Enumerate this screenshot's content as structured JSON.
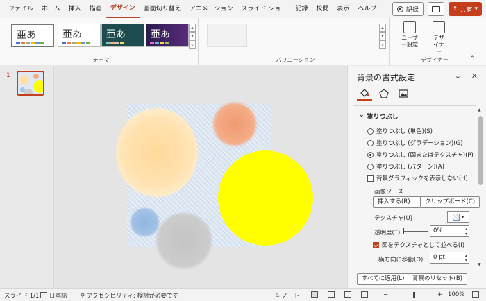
{
  "menubar": {
    "items": [
      "ファイル",
      "ホーム",
      "挿入",
      "描画",
      "デザイン",
      "画面切り替え",
      "アニメーション",
      "スライド ショー",
      "記録",
      "校閲",
      "表示",
      "ヘルプ"
    ],
    "active": "デザイン",
    "record_label": "記録",
    "share_label": "共有"
  },
  "ribbon": {
    "theme_group_label": "テーマ",
    "theme_glyph": "亜あ",
    "variation_group_label": "バリエーション",
    "designer_group_label": "デザイナー",
    "user_settings_label": "ユーザー設定",
    "designer_label": "デザイナー"
  },
  "thumbs": {
    "slide_number": "1"
  },
  "format_pane": {
    "title": "背景の書式設定",
    "section": "塗りつぶし",
    "options": [
      {
        "label": "塗りつぶし (単色)(S)",
        "selected": false
      },
      {
        "label": "塗りつぶし (グラデーション)(G)",
        "selected": false
      },
      {
        "label": "塗りつぶし (図またはテクスチャ)(P)",
        "selected": true
      },
      {
        "label": "塗りつぶし (パターン)(A)",
        "selected": false
      }
    ],
    "hide_graphics_label": "背景グラフィックを表示しない(H)",
    "image_source_label": "画像ソース",
    "insert_button": "挿入する(R)...",
    "clipboard_button": "クリップボード(C)",
    "texture_label": "テクスチャ(U)",
    "transparency_label": "透明度(T)",
    "transparency_value": "0%",
    "tile_label": "図をテクスチャとして並べる(I)",
    "offset_x_label": "横方向に移動(O)",
    "offset_x_value": "0 pt",
    "apply_all_button": "すべてに適用(L)",
    "reset_button": "背景のリセット(B)"
  },
  "status": {
    "slide": "スライド 1/1",
    "language": "日本語",
    "accessibility": "アクセシビリティ: 検討が必要です",
    "notes": "ノート",
    "zoom": "100%"
  },
  "colors": {
    "accent": "#c43e1c",
    "yellow_circle": "#ffff00",
    "slide_bg": "#dbe6f2"
  }
}
